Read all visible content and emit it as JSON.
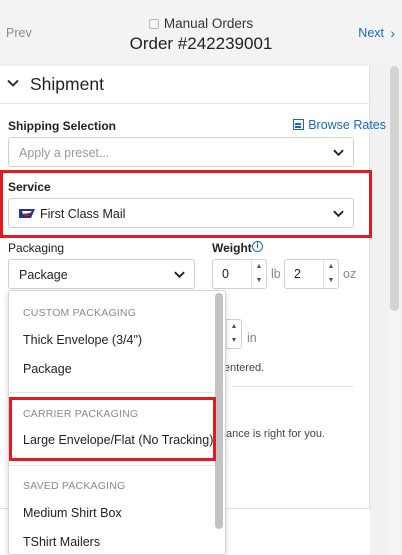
{
  "header": {
    "prev_label": "Prev",
    "next_label": "Next",
    "subtitle": "Manual Orders",
    "title": "Order #242239001"
  },
  "shipment": {
    "section_title": "Shipment",
    "shipping_selection_label": "Shipping Selection",
    "browse_rates_label": "Browse Rates",
    "preset_placeholder": "Apply a preset...",
    "service_label": "Service",
    "service_value": "First Class Mail",
    "packaging_label": "Packaging",
    "packaging_value": "Package",
    "weight_label": "Weight",
    "weight_lb": "0",
    "weight_lb_unit": "lb",
    "weight_oz": "2",
    "weight_oz_unit": "oz",
    "dimension_unit": "in",
    "behind_text_1": "re entered.",
    "behind_text_2": "ance is right for you."
  },
  "packaging_dropdown": {
    "groups": [
      {
        "label": "CUSTOM PACKAGING",
        "items": [
          "Thick Envelope (3/4\")",
          "Package"
        ]
      },
      {
        "label": "CARRIER PACKAGING",
        "items": [
          "Large Envelope/Flat (No Tracking)"
        ]
      },
      {
        "label": "SAVED PACKAGING",
        "items": [
          "Medium Shirt Box",
          "TShirt Mailers"
        ]
      }
    ]
  },
  "colors": {
    "accent": "#1a66c7",
    "highlight": "#e21b23"
  }
}
